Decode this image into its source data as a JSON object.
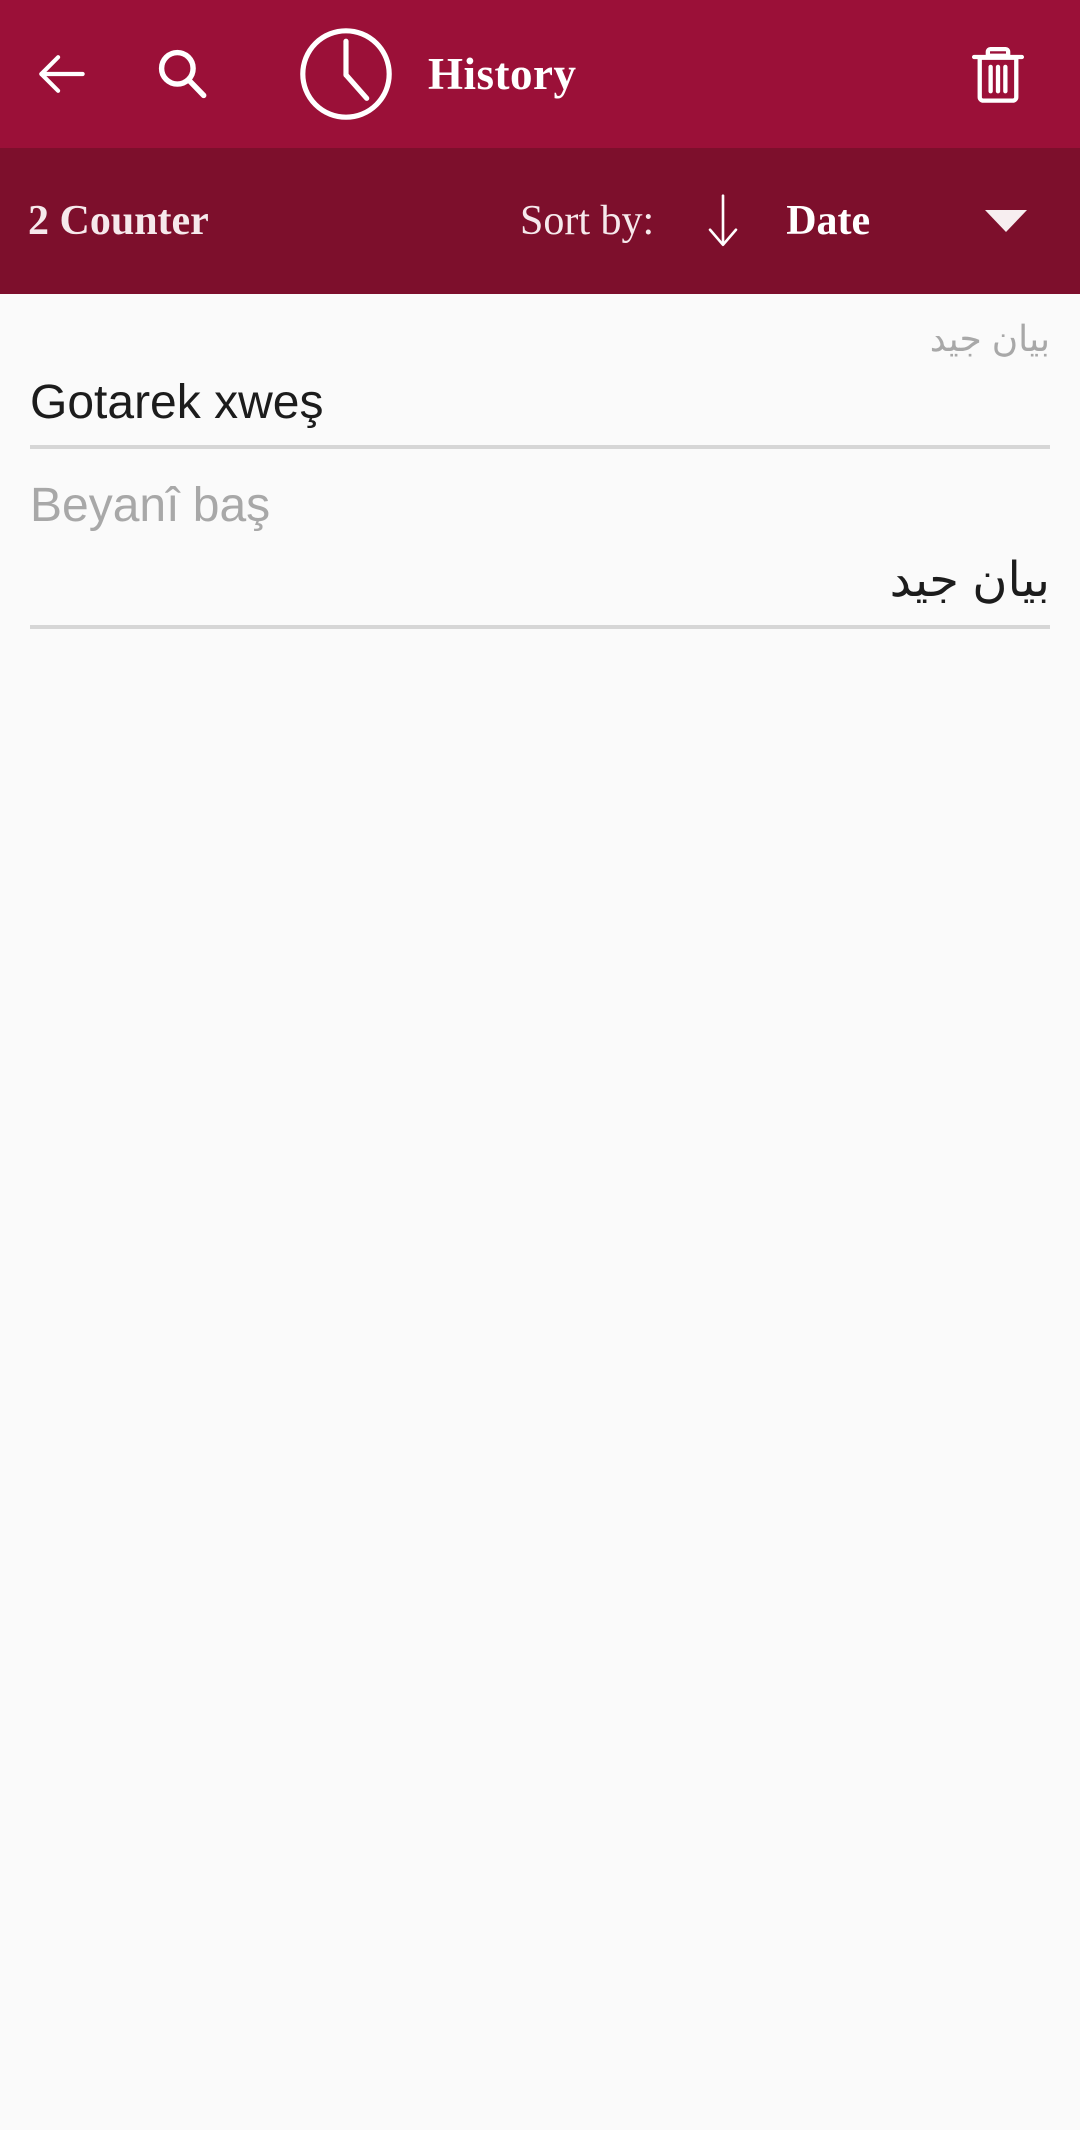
{
  "appbar": {
    "title": "History",
    "back_icon": "back-arrow-icon",
    "search_icon": "search-icon",
    "clock_icon": "clock-icon",
    "delete_icon": "trash-icon",
    "background_color": "#9b1038",
    "foreground_color": "#ffffff"
  },
  "sortbar": {
    "counter_label": "2 Counter",
    "sort_by_label": "Sort by:",
    "sort_direction_icon": "arrow-down-icon",
    "sort_value": "Date",
    "dropdown_icon": "caret-down-icon",
    "background_color": "#7d0f2c"
  },
  "history": {
    "entries": [
      {
        "secondary_text": "بيان جيد",
        "primary_text": "Gotarek xweş",
        "primary_dir": "ltr",
        "secondary_dir": "rtl"
      },
      {
        "secondary_text": "Beyanî baş",
        "primary_text": "بيان جيد",
        "primary_dir": "rtl",
        "secondary_dir": "ltr"
      }
    ]
  },
  "colors": {
    "content_background": "#fafafa",
    "primary_text": "#1c1c1c",
    "secondary_text": "#a8a8a8",
    "divider": "#d6d6d6"
  }
}
